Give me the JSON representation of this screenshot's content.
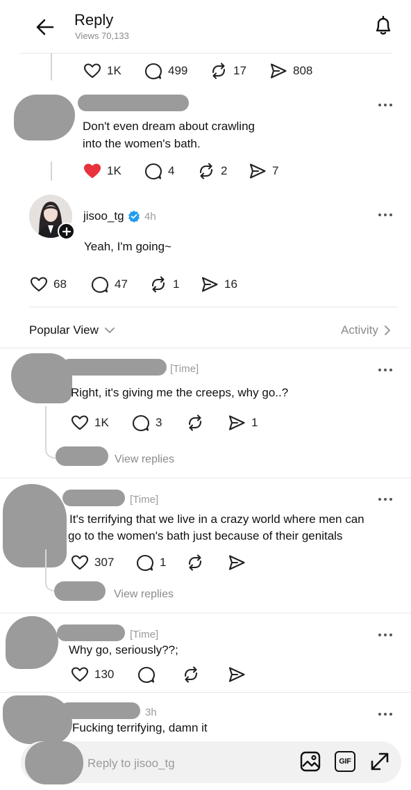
{
  "header": {
    "title": "Reply",
    "views": "Views 70,133"
  },
  "top_stats": {
    "likes": "1K",
    "replies": "499",
    "reposts": "17",
    "shares": "808"
  },
  "comment1": {
    "text_line1": "Don't even dream about crawling",
    "text_line2": "into the women's bath.",
    "likes": "1K",
    "replies": "4",
    "reposts": "2",
    "shares": "7"
  },
  "main_post": {
    "username": "jisoo_tg",
    "time": "4h",
    "text": "Yeah, I'm going~",
    "likes": "68",
    "replies": "47",
    "reposts": "1",
    "shares": "16"
  },
  "sort": {
    "label": "Popular View",
    "activity": "Activity"
  },
  "replies": [
    {
      "time": "[Time]",
      "line1": "Right, it's giving me the creeps, why go..?",
      "line2": "",
      "likes": "1K",
      "replies": "3",
      "reposts": "",
      "shares": "1",
      "view_replies": "View replies"
    },
    {
      "time": "[Time]",
      "line1": "It's terrifying that we live in a crazy world where men can",
      "line2": "go to the women's bath just because of their genitals",
      "likes": "307",
      "replies": "1",
      "reposts": "",
      "shares": "",
      "view_replies": "View replies"
    },
    {
      "time": "[Time]",
      "line1": "Why go, seriously??;",
      "line2": "",
      "likes": "130",
      "replies": "",
      "reposts": "",
      "shares": ""
    },
    {
      "time": "3h",
      "line1": "Fucking terrifying, damn it",
      "line2": ""
    }
  ],
  "composer": {
    "placeholder": "Reply to jisoo_tg",
    "gif": "GIF"
  },
  "colors": {
    "verified": "#1d9bf0",
    "liked": "#e8323c",
    "redaction": "#9b9b9b"
  }
}
